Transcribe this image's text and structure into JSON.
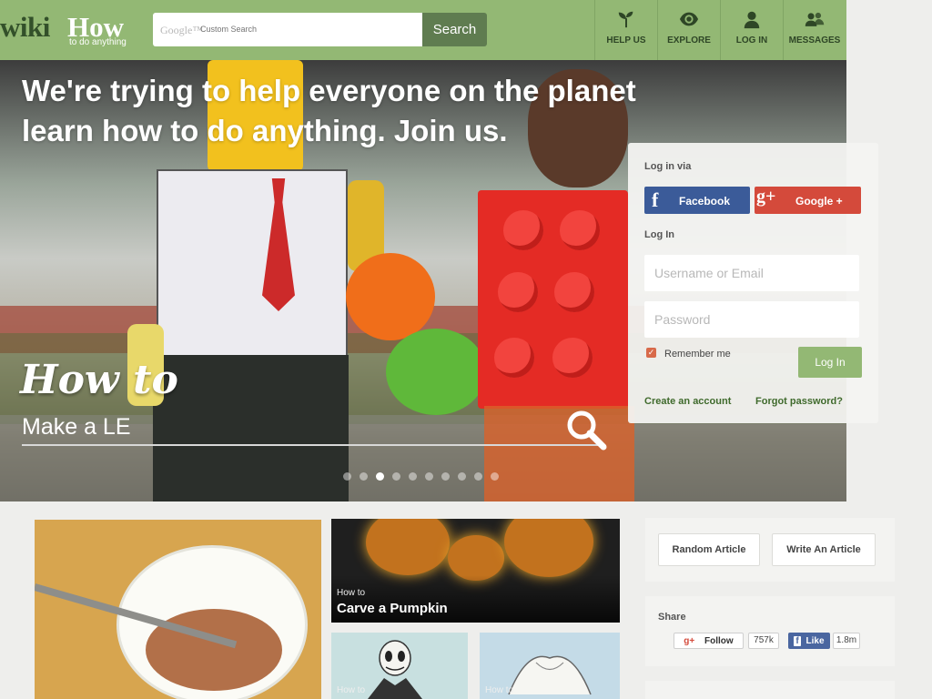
{
  "header": {
    "logo_wiki": "wiki",
    "logo_how": "How",
    "logo_tagline": "to do anything",
    "search_brand": "Google™",
    "search_placeholder": "Custom Search",
    "search_button": "Search",
    "nav": [
      {
        "label": "HELP US",
        "icon": "sprout-icon"
      },
      {
        "label": "EXPLORE",
        "icon": "eye-icon"
      },
      {
        "label": "LOG IN",
        "icon": "user-icon"
      },
      {
        "label": "MESSAGES",
        "icon": "users-icon"
      }
    ]
  },
  "hero": {
    "headline": "We're trying to help everyone on the planet learn how to do anything. Join us.",
    "how_to": "How to",
    "search_value": "Make a LE",
    "slide_count": 10,
    "active_slide": 3
  },
  "login": {
    "via_label": "Log in via",
    "facebook": "Facebook",
    "google": "Google +",
    "login_label": "Log In",
    "username_placeholder": "Username or Email",
    "password_placeholder": "Password",
    "remember_me": "Remember me",
    "login_button": "Log In",
    "create_account": "Create an account",
    "forgot_password": "Forgot password?"
  },
  "featured": {
    "pumpkin_howto": "How to",
    "pumpkin_title": "Carve a Pumpkin",
    "small_howto_1": "How to",
    "small_howto_2": "How to"
  },
  "sidebar": {
    "random_article": "Random Article",
    "write_article": "Write An Article",
    "share_label": "Share",
    "gplus_follow": "Follow",
    "gplus_count": "757k",
    "fb_like": "Like",
    "fb_count": "1.8m"
  },
  "colors": {
    "header_green": "#93b874",
    "dark_green": "#5f7c50",
    "facebook_blue": "#3b5b99",
    "google_red": "#d44a3b"
  }
}
